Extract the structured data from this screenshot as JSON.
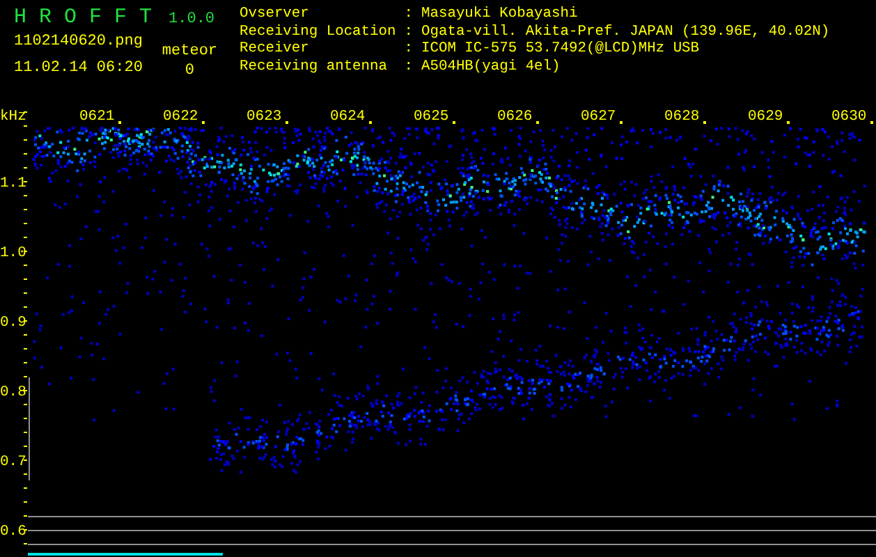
{
  "app": {
    "title": "H R O F F T",
    "version": "1.0.0",
    "filename": "1102140620.png",
    "datetime": "11.02.14 06:20",
    "meteor_label": "meteor",
    "meteor_count": "0"
  },
  "info": [
    {
      "label": "Ovserver",
      "separator": ":",
      "value": "Masayuki Kobayashi"
    },
    {
      "label": "Receiving Location",
      "separator": ":",
      "value": "Ogata-vill. Akita-Pref. JAPAN (139.96E, 40.02N)"
    },
    {
      "label": "Receiver",
      "separator": ":",
      "value": "ICOM IC-575 53.7492(@LCD)MHz USB"
    },
    {
      "label": "Receiving antenna",
      "separator": ":",
      "value": "A504HB(yagi 4el)"
    }
  ],
  "spectrogram": {
    "unit": "kHz",
    "time_labels": [
      "0621",
      "0622",
      "0623",
      "0624",
      "0625",
      "0626",
      "0627",
      "0628",
      "0629",
      "0630"
    ],
    "freq_labels": [
      "1.1",
      "1.0",
      "0.9",
      "0.8",
      "0.7",
      "0.6"
    ]
  }
}
